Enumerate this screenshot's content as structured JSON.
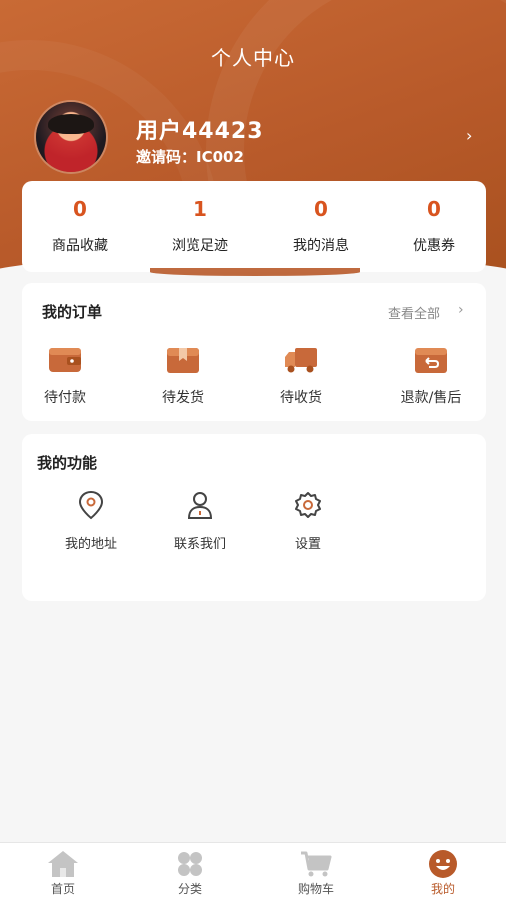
{
  "header": {
    "title": "个人中心"
  },
  "profile": {
    "username": "用户44423",
    "invite_code": "邀请码：IC002"
  },
  "stats": [
    {
      "value": "0",
      "label": "商品收藏"
    },
    {
      "value": "1",
      "label": "浏览足迹"
    },
    {
      "value": "0",
      "label": "我的消息"
    },
    {
      "value": "0",
      "label": "优惠券"
    }
  ],
  "orders": {
    "title": "我的订单",
    "view_all": "查看全部",
    "items": [
      {
        "label": "待付款",
        "icon": "wallet-icon"
      },
      {
        "label": "待发货",
        "icon": "package-icon"
      },
      {
        "label": "待收货",
        "icon": "truck-icon"
      },
      {
        "label": "退款/售后",
        "icon": "refund-box-icon"
      }
    ]
  },
  "functions": {
    "title": "我的功能",
    "items": [
      {
        "label": "我的地址",
        "icon": "location-pin-icon"
      },
      {
        "label": "联系我们",
        "icon": "contact-person-icon"
      },
      {
        "label": "设置",
        "icon": "settings-gear-icon"
      }
    ]
  },
  "tabbar": [
    {
      "label": "首页",
      "icon": "home-icon"
    },
    {
      "label": "分类",
      "icon": "category-icon"
    },
    {
      "label": "购物车",
      "icon": "cart-icon"
    },
    {
      "label": "我的",
      "icon": "smile-face-icon",
      "active": true
    }
  ],
  "colors": {
    "brand": "#b85a2a",
    "accent_number": "#d8541f",
    "tab_inactive": "#bdbdbd"
  }
}
